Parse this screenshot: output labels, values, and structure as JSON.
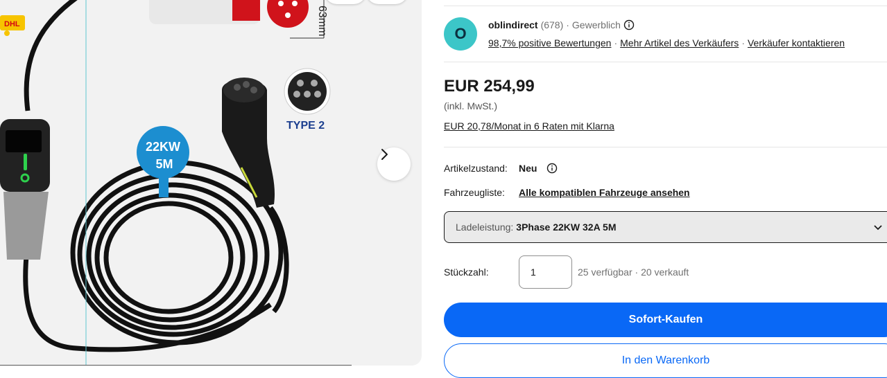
{
  "gallery": {
    "badge_power": "22KW",
    "badge_length": "5M",
    "connector_label": "TYPE 2",
    "dimension_label": "63mm",
    "courier_label": "DHL",
    "next_icon": "chevron-right-icon"
  },
  "seller": {
    "avatar_letter": "O",
    "name": "oblindirect",
    "feedback_count": "(678)",
    "type": "Gewerblich",
    "positive_rating": "98,7% positive Bewertungen",
    "more_items": "Mehr Artikel des Verkäufers",
    "contact": "Verkäufer kontaktieren",
    "avatar_color": "#3cc6c8"
  },
  "price": {
    "amount": "EUR 254,99",
    "vat_note": "(inkl. MwSt.)",
    "installments": "EUR 20,78/Monat in 6 Raten mit Klarna"
  },
  "details": {
    "condition_label": "Artikelzustand:",
    "condition_value": "Neu",
    "vehicle_label": "Fahrzeugliste:",
    "vehicle_link": "Alle kompatiblen Fahrzeuge ansehen"
  },
  "variant": {
    "label": "Ladeleistung:",
    "selected": "3Phase 22KW 32A 5M"
  },
  "quantity": {
    "label": "Stückzahl:",
    "value": "1",
    "available": "25 verfügbar",
    "sold": "20 verkauft"
  },
  "actions": {
    "buy_now": "Sofort-Kaufen",
    "add_to_cart": "In den Warenkorb",
    "primary_color": "#0968f6"
  }
}
